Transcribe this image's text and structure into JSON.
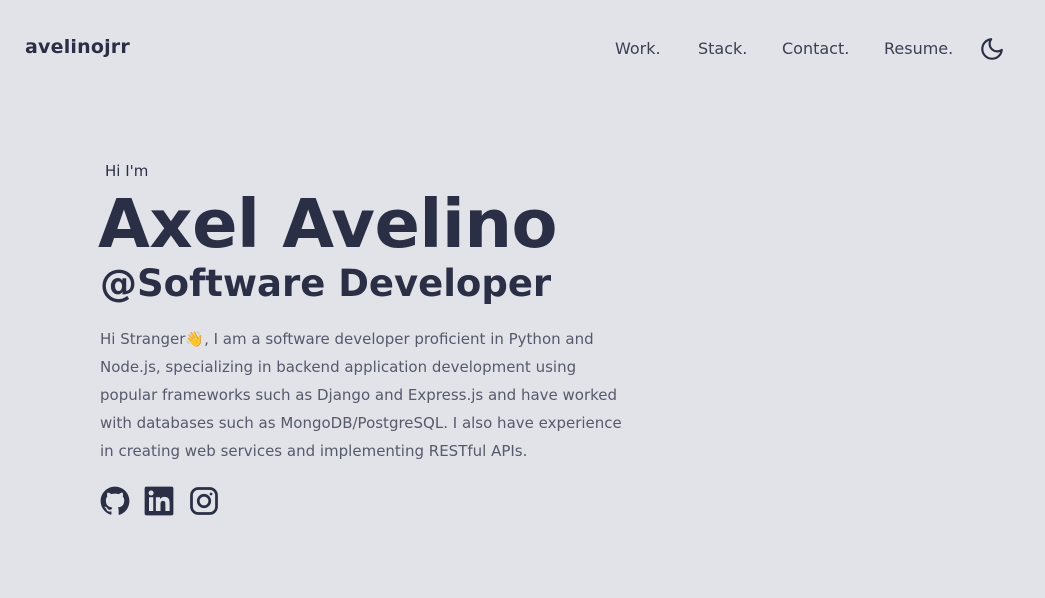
{
  "header": {
    "brand": "avelinojrr",
    "nav": [
      {
        "label": "Work."
      },
      {
        "label": "Stack."
      },
      {
        "label": "Contact."
      },
      {
        "label": "Resume."
      }
    ],
    "theme_icon": "moon-icon"
  },
  "hero": {
    "greeting": "Hi I'm",
    "name": "Axel Avelino",
    "role": "@Software Developer",
    "bio": "Hi Stranger👋, I am a software developer proficient in Python and Node.js, specializing in backend application development using popular frameworks such as Django and Express.js and have worked with databases such as MongoDB/PostgreSQL. I also have experience in creating web services and implementing RESTful APIs."
  },
  "socials": [
    {
      "icon": "github-icon"
    },
    {
      "icon": "linkedin-icon"
    },
    {
      "icon": "instagram-icon"
    }
  ],
  "colors": {
    "background": "#e2e3e9",
    "text_primary": "#2a2f45",
    "text_secondary": "#555a6b"
  }
}
